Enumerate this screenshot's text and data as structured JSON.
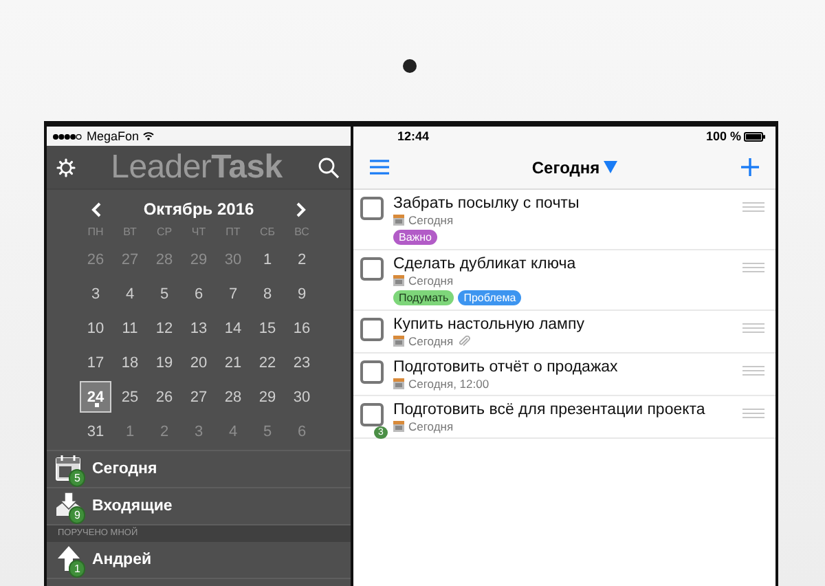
{
  "left_status": {
    "carrier": "MegaFon"
  },
  "sidebar_header": {
    "logo": "Leader**Task**"
  },
  "calendar": {
    "month": "Октябрь 2016",
    "weekdays": [
      "ПН",
      "ВТ",
      "СР",
      "ЧТ",
      "ПТ",
      "СБ",
      "ВС"
    ],
    "days": [
      {
        "label": "26",
        "dim": true,
        "selected": false,
        "marked": false
      },
      {
        "label": "27",
        "dim": true,
        "selected": false,
        "marked": false
      },
      {
        "label": "28",
        "dim": true,
        "selected": false,
        "marked": false
      },
      {
        "label": "29",
        "dim": true,
        "selected": false,
        "marked": false
      },
      {
        "label": "30",
        "dim": true,
        "selected": false,
        "marked": false
      },
      {
        "label": "1",
        "dim": false,
        "selected": false,
        "marked": false
      },
      {
        "label": "2",
        "dim": false,
        "selected": false,
        "marked": false
      },
      {
        "label": "3",
        "dim": false,
        "selected": false,
        "marked": false
      },
      {
        "label": "4",
        "dim": false,
        "selected": false,
        "marked": false
      },
      {
        "label": "5",
        "dim": false,
        "selected": false,
        "marked": false
      },
      {
        "label": "6",
        "dim": false,
        "selected": false,
        "marked": false
      },
      {
        "label": "7",
        "dim": false,
        "selected": false,
        "marked": false
      },
      {
        "label": "8",
        "dim": false,
        "selected": false,
        "marked": false
      },
      {
        "label": "9",
        "dim": false,
        "selected": false,
        "marked": false
      },
      {
        "label": "10",
        "dim": false,
        "selected": false,
        "marked": false
      },
      {
        "label": "11",
        "dim": false,
        "selected": false,
        "marked": false
      },
      {
        "label": "12",
        "dim": false,
        "selected": false,
        "marked": false
      },
      {
        "label": "13",
        "dim": false,
        "selected": false,
        "marked": false
      },
      {
        "label": "14",
        "dim": false,
        "selected": false,
        "marked": false
      },
      {
        "label": "15",
        "dim": false,
        "selected": false,
        "marked": false
      },
      {
        "label": "16",
        "dim": false,
        "selected": false,
        "marked": false
      },
      {
        "label": "17",
        "dim": false,
        "selected": false,
        "marked": false
      },
      {
        "label": "18",
        "dim": false,
        "selected": false,
        "marked": false
      },
      {
        "label": "19",
        "dim": false,
        "selected": false,
        "marked": false
      },
      {
        "label": "20",
        "dim": false,
        "selected": false,
        "marked": false
      },
      {
        "label": "21",
        "dim": false,
        "selected": false,
        "marked": false
      },
      {
        "label": "22",
        "dim": false,
        "selected": false,
        "marked": false
      },
      {
        "label": "23",
        "dim": false,
        "selected": false,
        "marked": false
      },
      {
        "label": "24",
        "dim": false,
        "selected": true,
        "marked": true
      },
      {
        "label": "25",
        "dim": false,
        "selected": false,
        "marked": false
      },
      {
        "label": "26",
        "dim": false,
        "selected": false,
        "marked": false
      },
      {
        "label": "27",
        "dim": false,
        "selected": false,
        "marked": false
      },
      {
        "label": "28",
        "dim": false,
        "selected": false,
        "marked": false
      },
      {
        "label": "29",
        "dim": false,
        "selected": false,
        "marked": false
      },
      {
        "label": "30",
        "dim": false,
        "selected": false,
        "marked": false
      },
      {
        "label": "31",
        "dim": false,
        "selected": false,
        "marked": false
      },
      {
        "label": "1",
        "dim": true,
        "selected": false,
        "marked": false
      },
      {
        "label": "2",
        "dim": true,
        "selected": false,
        "marked": false
      },
      {
        "label": "3",
        "dim": true,
        "selected": false,
        "marked": false
      },
      {
        "label": "4",
        "dim": true,
        "selected": false,
        "marked": false
      },
      {
        "label": "5",
        "dim": true,
        "selected": false,
        "marked": false
      },
      {
        "label": "6",
        "dim": true,
        "selected": false,
        "marked": false
      }
    ]
  },
  "sidebar": {
    "items": [
      {
        "kind": "calendar",
        "label": "Сегодня",
        "badge": "5"
      },
      {
        "kind": "inbox",
        "label": "Входящие",
        "badge": "9"
      },
      {
        "kind": "section",
        "label": "ПОРУЧЕНО МНОЙ"
      },
      {
        "kind": "person",
        "label": "Андрей",
        "badge": "1"
      }
    ]
  },
  "right_status": {
    "time": "12:44",
    "battery": "100 %"
  },
  "nav": {
    "title": "Сегодня"
  },
  "tasks": [
    {
      "title": "Забрать посылку с почты",
      "date": "Сегодня",
      "checked": false,
      "attachment": false,
      "tags": [
        {
          "label": "Важно",
          "color": "#b25cc7"
        }
      ]
    },
    {
      "title": "Сделать дубликат ключа",
      "date": "Сегодня",
      "checked": false,
      "attachment": false,
      "tags": [
        {
          "label": "Подумать",
          "color": "#7ed67a"
        },
        {
          "label": "Проблема",
          "color": "#3d95f0"
        }
      ]
    },
    {
      "title": "Купить настольную лампу",
      "date": "Сегодня",
      "checked": false,
      "attachment": true
    },
    {
      "title": "Подготовить отчёт о продажах",
      "date": "Сегодня, 12:00",
      "checked": false,
      "attachment": false
    },
    {
      "title": "Подготовить всё для презентации проекта",
      "date": "Сегодня",
      "checked": false,
      "attachment": false,
      "subtasks": "3"
    }
  ]
}
